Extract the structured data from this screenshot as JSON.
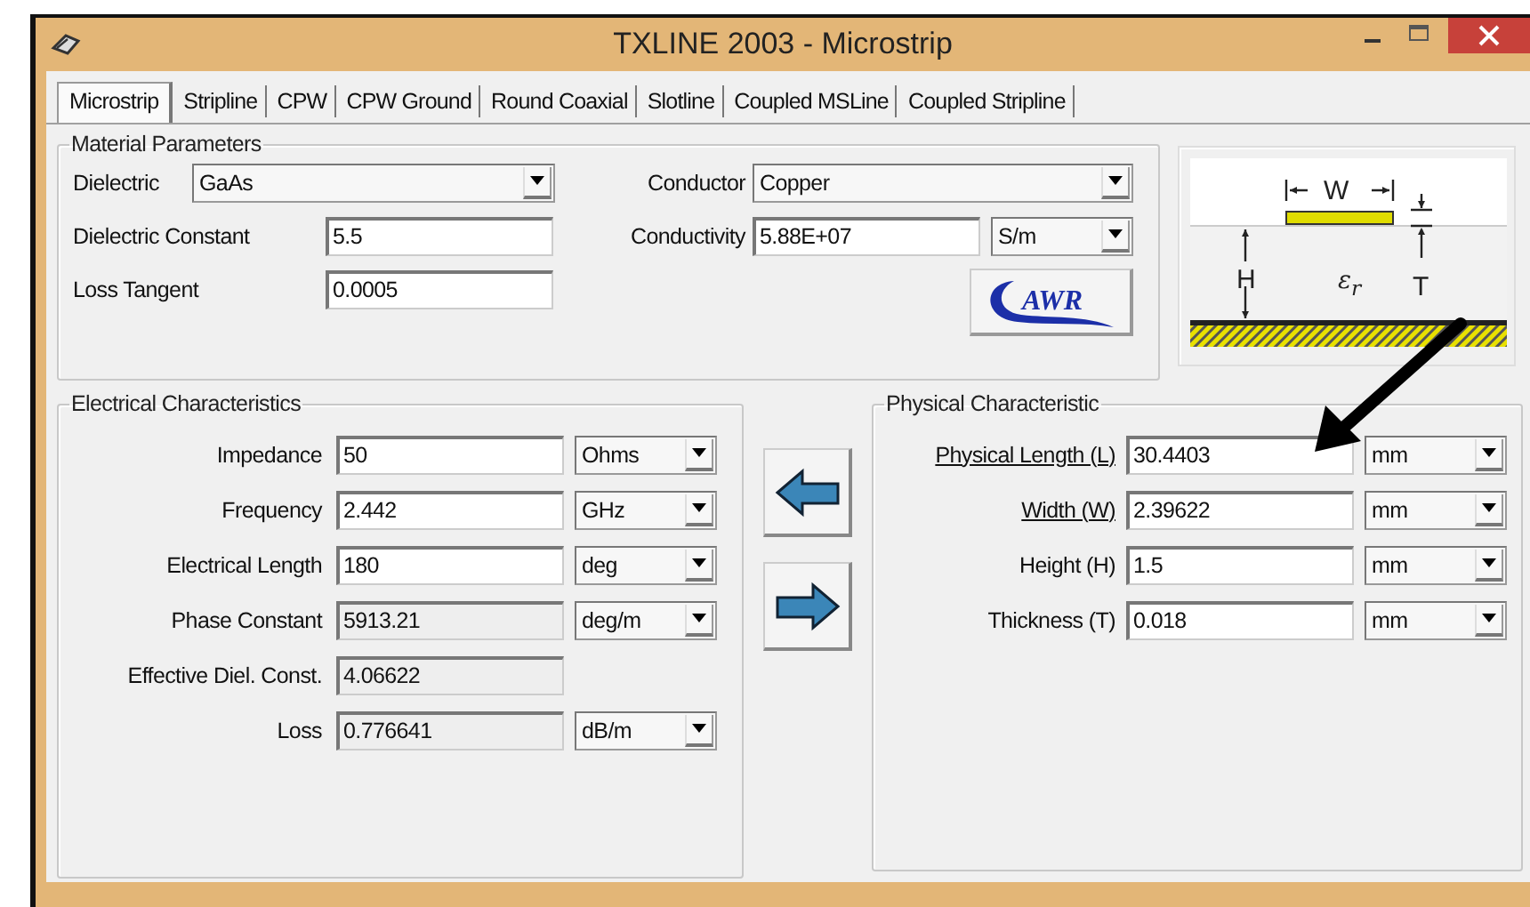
{
  "window": {
    "title": "TXLINE 2003 - Microstrip"
  },
  "tabs": [
    {
      "label": "Microstrip",
      "selected": true
    },
    {
      "label": "Stripline",
      "selected": false
    },
    {
      "label": "CPW",
      "selected": false
    },
    {
      "label": "CPW Ground",
      "selected": false
    },
    {
      "label": "Round Coaxial",
      "selected": false
    },
    {
      "label": "Slotline",
      "selected": false
    },
    {
      "label": "Coupled MSLine",
      "selected": false
    },
    {
      "label": "Coupled Stripline",
      "selected": false
    }
  ],
  "material": {
    "title": "Material Parameters",
    "left": [
      {
        "kind": "dropdown",
        "label": "Dielectric",
        "value": "GaAs"
      },
      {
        "kind": "input",
        "label": "Dielectric Constant",
        "value": "5.5"
      },
      {
        "kind": "input",
        "label": "Loss Tangent",
        "value": "0.0005"
      }
    ],
    "right": [
      {
        "kind": "dropdown",
        "label": "Conductor",
        "value": "Copper"
      },
      {
        "kind": "input",
        "label": "Conductivity",
        "value": "5.88E+07",
        "unit": "S/m"
      }
    ],
    "logo": "AWR"
  },
  "diagram": {
    "width_label": "W",
    "height_label": "H",
    "thickness_label": "T",
    "permittivity_label": "ε$_{r}$"
  },
  "electrical": {
    "title": "Electrical Characteristics",
    "rows": [
      {
        "label": "Impedance",
        "value": "50",
        "unit": "Ohms",
        "readonly": false
      },
      {
        "label": "Frequency",
        "value": "2.442",
        "unit": "GHz",
        "readonly": false
      },
      {
        "label": "Electrical Length",
        "value": "180",
        "unit": "deg",
        "readonly": false
      },
      {
        "label": "Phase Constant",
        "value": "5913.21",
        "unit": "deg/m",
        "readonly": true
      },
      {
        "label": "Effective Diel. Const.",
        "value": "4.06622",
        "readonly": true
      },
      {
        "label": "Loss",
        "value": "0.776641",
        "unit": "dB/m",
        "readonly": true
      }
    ]
  },
  "actions": [
    {
      "kind": "left"
    },
    {
      "kind": "right"
    }
  ],
  "physical": {
    "title": "Physical Characteristic",
    "rows": [
      {
        "label": "Physical Length (L)",
        "value": "30.4403",
        "unit": "mm",
        "underlined": true
      },
      {
        "label": "Width (W)",
        "value": "2.39622",
        "unit": "mm",
        "underlined": true
      },
      {
        "label": "Height (H)",
        "value": "1.5",
        "unit": "mm",
        "underlined": false
      },
      {
        "label": "Thickness (T)",
        "value": "0.018",
        "unit": "mm",
        "underlined": false
      }
    ]
  }
}
